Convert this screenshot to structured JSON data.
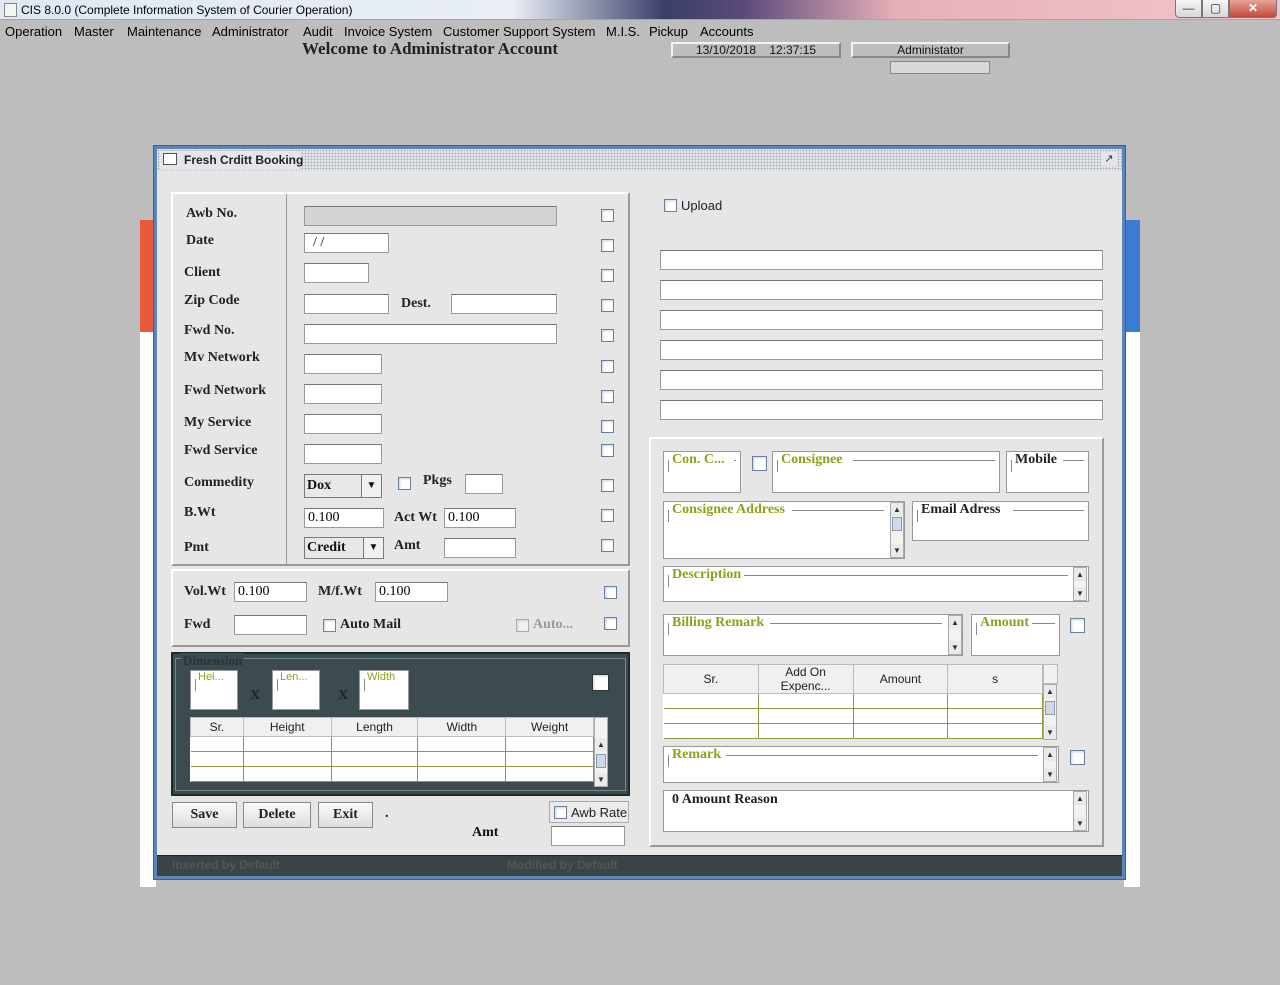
{
  "app": {
    "title": "CIS 8.0.0 (Complete Information System of Courier Operation)",
    "minimize": "—",
    "maximize": "▢",
    "close": "✕"
  },
  "menu": [
    "Operation",
    "Master",
    "Maintenance",
    "Administrator",
    "Audit",
    "Invoice System",
    "Customer Support System",
    "M.I.S.",
    "Pickup",
    "Accounts"
  ],
  "header": {
    "welcome": "Welcome to Administrator Account",
    "date": "13/10/2018",
    "time": "12:37:15",
    "user": "Administator"
  },
  "frame": {
    "title": "Fresh Crditt Booking",
    "restore": "↗"
  },
  "booking": {
    "awb_label": "Awb No.",
    "awb_value": "",
    "date_label": "Date",
    "date_value": "/ /",
    "client_label": "Client",
    "zip_label": "Zip Code",
    "dest_label": "Dest.",
    "fwd_no_label": "Fwd No.",
    "my_network_label": "Mv Network",
    "fwd_network_label": "Fwd Network",
    "my_service_label": "My Service",
    "fwd_service_label": "Fwd Service",
    "commodity_label": "Commedity",
    "commodity_value": "Dox",
    "pkgs_label": "Pkgs",
    "bwt_label": "B.Wt",
    "bwt_value": "0.100",
    "actwt_label": "Act Wt",
    "actwt_value": "0.100",
    "pmt_label": "Pmt",
    "pmt_value": "Credit",
    "amt_label": "Amt"
  },
  "weights": {
    "volwt_label": "Vol.Wt",
    "volwt_value": "0.100",
    "mfwt_label": "M/f.Wt",
    "mfwt_value": "0.100",
    "fwd_label": "Fwd",
    "automail_label": "Auto Mail",
    "auto_label": "Auto..."
  },
  "dimension": {
    "title": "Dimension",
    "height_label": "Hei...",
    "length_label": "Len...",
    "width_label": "Width",
    "x1": "X",
    "x2": "X",
    "columns": [
      "Sr.",
      "Height",
      "Length",
      "Width",
      "Weight"
    ]
  },
  "actions": {
    "save": "Save",
    "delete": "Delete",
    "exit": "Exit",
    "dot": ".",
    "awb_rate": "Awb Rate",
    "amt": "Amt"
  },
  "right": {
    "upload": "Upload",
    "con_code": "Con. C...",
    "consignee": "Consignee",
    "mobile": "Mobile",
    "consignee_address": "Consignee Address",
    "email": "Email Adress",
    "description": "Description",
    "billing_remark": "Billing Remark",
    "amount": "Amount",
    "addon_columns": [
      "Sr.",
      "Add On Expenc...",
      "Amount",
      "s"
    ],
    "remark": "Remark",
    "zero_amount_reason": "0 Amount Reason"
  },
  "status": {
    "inserted": "Inserted by    Default",
    "modified": "Modified by  Default"
  }
}
